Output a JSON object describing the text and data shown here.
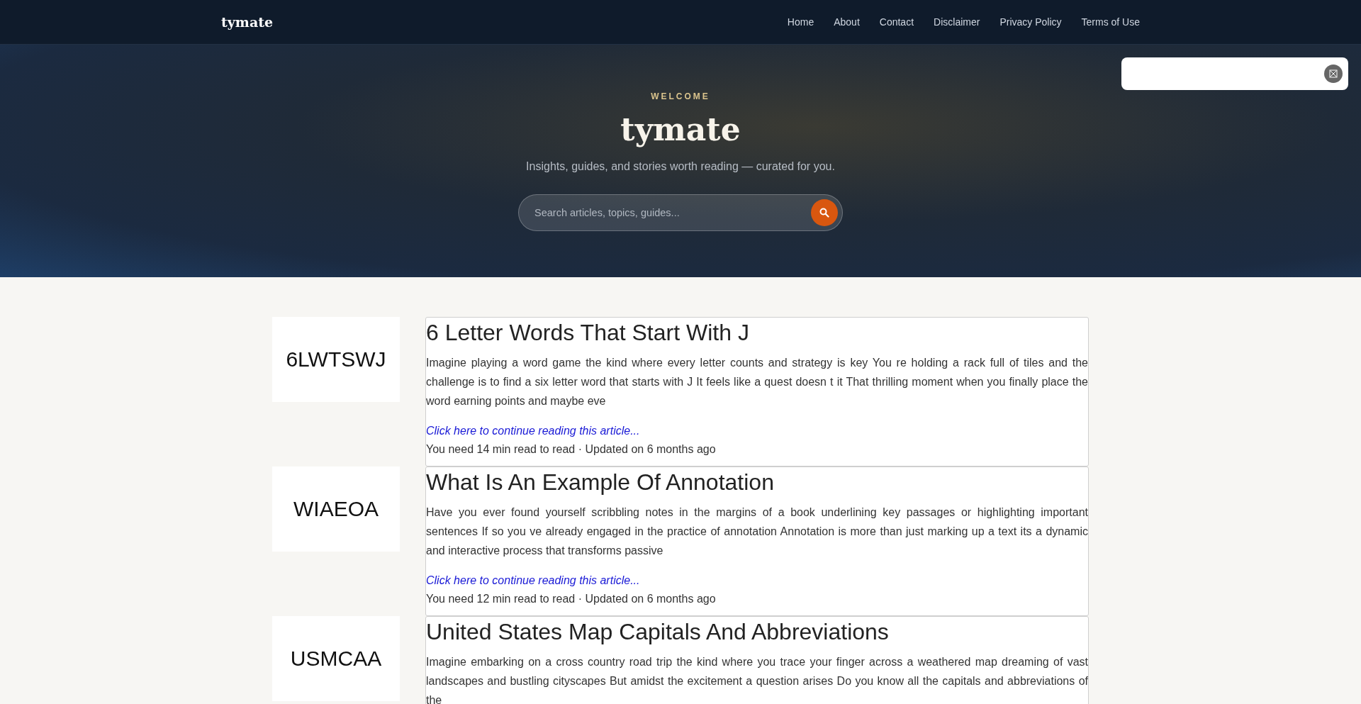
{
  "header": {
    "logo": "tymate",
    "nav": [
      "Home",
      "About",
      "Contact",
      "Disclaimer",
      "Privacy Policy",
      "Terms of Use"
    ]
  },
  "hero": {
    "eyebrow": "WELCOME",
    "title": "tymate",
    "subtitle": "Insights, guides, and stories worth reading — curated for you.",
    "search": {
      "placeholder": "Search articles, topics, guides..."
    }
  },
  "articles": [
    {
      "thumbnail": "6LWTSWJ",
      "title": "6 Letter Words That Start With J",
      "excerpt": "Imagine playing a word game the kind where every letter counts and strategy is key You re holding a rack full of tiles and the challenge is to find a six letter word that starts with J It feels like a quest doesn t it That thrilling moment when you finally place the word earning points and maybe eve",
      "link": "Click here to continue reading this article...",
      "meta": "You need 14 min read to read · Updated on 6 months ago"
    },
    {
      "thumbnail": "WIAEOA",
      "title": "What Is An Example Of Annotation",
      "excerpt": "Have you ever found yourself scribbling notes in the margins of a book underlining key passages or highlighting important sentences If so you ve already engaged in the practice of annotation Annotation is more than just marking up a text its a dynamic and interactive process that transforms passive",
      "link": "Click here to continue reading this article...",
      "meta": "You need 12 min read to read · Updated on 6 months ago"
    },
    {
      "thumbnail": "USMCAA",
      "title": "United States Map Capitals And Abbreviations",
      "excerpt": "Imagine embarking on a cross country road trip the kind where you trace your finger across a weathered map dreaming of vast landscapes and bustling cityscapes But amidst the excitement a question arises Do you know all the capitals and abbreviations of the"
    }
  ]
}
